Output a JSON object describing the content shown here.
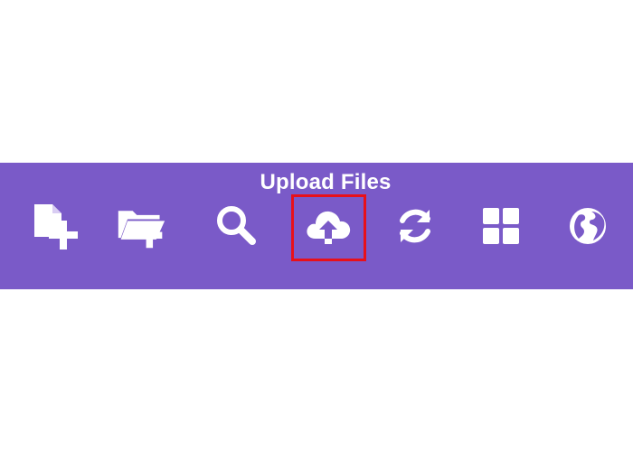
{
  "toolbar": {
    "background_color": "#7a5ac8",
    "tooltip": "Upload Files",
    "highlight_color": "#e8101a",
    "active_tool": "upload-files",
    "tools": [
      {
        "name": "new-file",
        "icon": "file-plus-icon"
      },
      {
        "name": "new-folder",
        "icon": "folder-plus-icon"
      },
      {
        "name": "search",
        "icon": "search-icon"
      },
      {
        "name": "upload-files",
        "icon": "cloud-upload-icon"
      },
      {
        "name": "refresh",
        "icon": "refresh-icon"
      },
      {
        "name": "grid-view",
        "icon": "grid-icon"
      },
      {
        "name": "browser",
        "icon": "globe-icon"
      }
    ]
  }
}
